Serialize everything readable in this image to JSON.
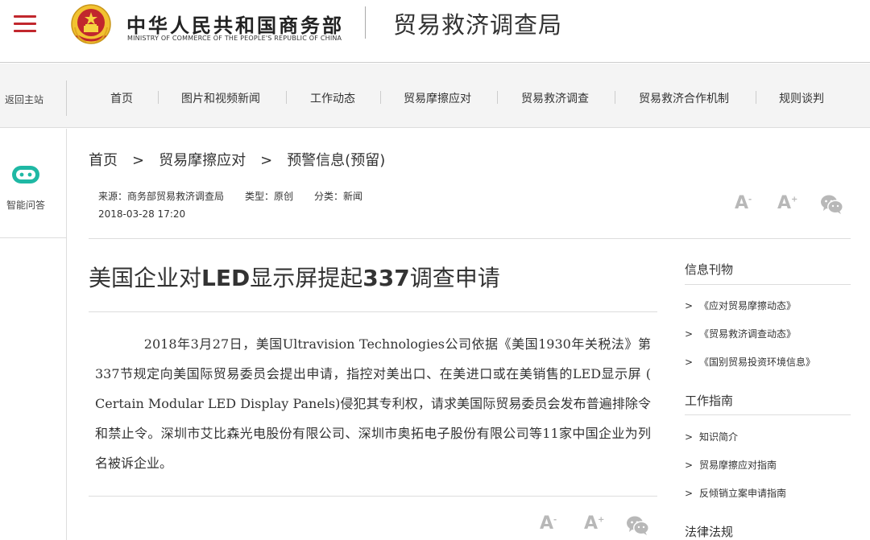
{
  "header": {
    "ministry_cn": "中华人民共和国商务部",
    "ministry_en": "MINISTRY OF COMMERCE OF THE PEOPLE'S REPUBLIC OF CHINA",
    "bureau": "贸易救济调查局",
    "brand_color": "#c1272d"
  },
  "nav": {
    "back_home": "返回主站",
    "items": [
      "首页",
      "图片和视频新闻",
      "工作动态",
      "贸易摩擦应对",
      "贸易救济调查",
      "贸易救济合作机制",
      "规则谈判"
    ]
  },
  "rail": {
    "assistant_label": "智能问答",
    "assistant_icon": "robot-icon",
    "accent_color": "#1fb8a4"
  },
  "breadcrumb": {
    "items": [
      "首页",
      "贸易摩擦应对",
      "预警信息(预留)"
    ],
    "separator": ">"
  },
  "meta": {
    "source": "来源：商务部贸易救济调查局",
    "type": "类型：原创",
    "category": "分类：新闻",
    "date": "2018-03-28 17:20"
  },
  "tools": {
    "font_smaller": "A",
    "font_smaller_sup": "-",
    "font_larger": "A",
    "font_larger_sup": "+",
    "share_icon": "wechat-icon"
  },
  "article": {
    "title_1": "美国企业对",
    "title_2": "LED",
    "title_3": "显示屏提起",
    "title_4": "337",
    "title_5": "调查申请",
    "body": "2018年3月27日，美国Ultravision Technologies公司依据《美国1930年关税法》第337节规定向美国际贸易委员会提出申请，指控对美出口、在美进口或在美销售的LED显示屏 ( Certain Modular LED Display Panels)侵犯其专利权，请求美国际贸易委员会发布普遍排除令和禁止令。深圳市艾比森光电股份有限公司、深圳市奥拓电子股份有限公司等11家中国企业为列名被诉企业。"
  },
  "sidebar": {
    "sections": [
      {
        "heading": "信息刊物",
        "links": [
          "《应对贸易摩擦动态》",
          "《贸易救济调查动态》",
          "《国别贸易投资环境信息》"
        ]
      },
      {
        "heading": "工作指南",
        "links": [
          "知识简介",
          "贸易摩擦应对指南",
          "反倾销立案申请指南"
        ]
      },
      {
        "heading": "法律法规",
        "links": []
      }
    ],
    "chevron": ">"
  }
}
